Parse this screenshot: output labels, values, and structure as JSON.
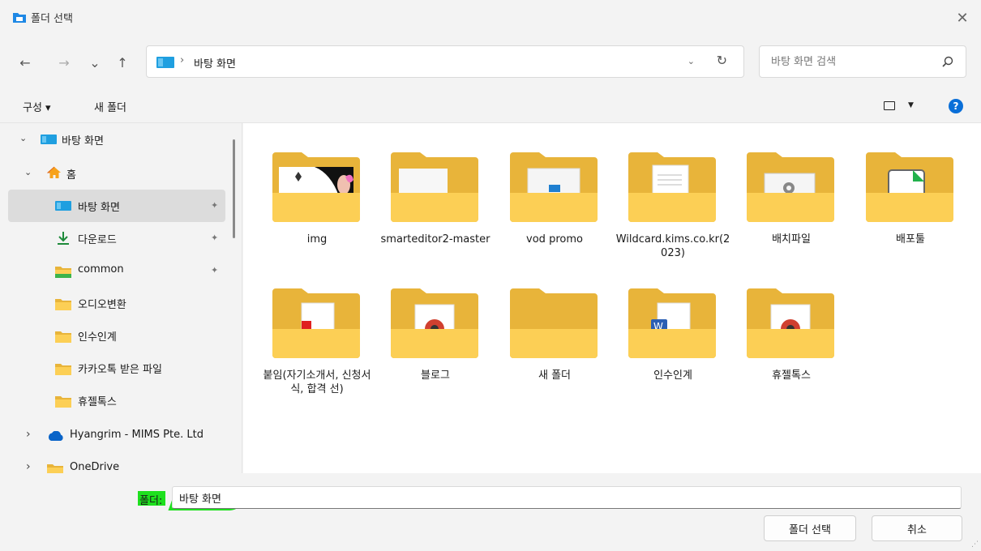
{
  "window": {
    "title": "폴더 선택",
    "close_glyph": "✕"
  },
  "nav": {
    "back_glyph": "←",
    "forward_glyph": "→",
    "recent_glyph": "⌄",
    "up_glyph": "↑",
    "breadcrumb_sep": "›",
    "path": "바탕 화면",
    "dropdown_glyph": "⌄",
    "refresh_glyph": "↻",
    "search_placeholder": "바탕 화면 검색"
  },
  "toolbar": {
    "organize": "구성 ▾",
    "new_folder": "새 폴더",
    "help": "?"
  },
  "sidebar": {
    "items": [
      {
        "label": "바탕 화면",
        "chevron": "⌄",
        "icon": "desktop-icon"
      },
      {
        "label": "홈",
        "chevron": "⌄",
        "icon": "home-icon"
      },
      {
        "label": "바탕 화면",
        "icon": "desktop-icon",
        "pinned": true
      },
      {
        "label": "다운로드",
        "icon": "download-icon",
        "pinned": true
      },
      {
        "label": "common",
        "icon": "folder-icon",
        "pinned": true
      },
      {
        "label": "오디오변환",
        "icon": "folder-icon"
      },
      {
        "label": "인수인계",
        "icon": "folder-icon"
      },
      {
        "label": "카카오톡 받은 파일",
        "icon": "folder-icon"
      },
      {
        "label": "휴젤톡스",
        "icon": "folder-icon"
      },
      {
        "label": "Hyangrim - MIMS Pte. Ltd",
        "chevron": "›",
        "icon": "cloud-icon"
      },
      {
        "label": "OneDrive",
        "chevron": "›",
        "icon": "folder-icon"
      }
    ],
    "pin_glyph": "📌"
  },
  "folders": [
    {
      "name": "img",
      "preview": "image"
    },
    {
      "name": "smarteditor2-master",
      "preview": "plain"
    },
    {
      "name": "vod promo",
      "preview": "video"
    },
    {
      "name": "Wildcard.kims.co.kr(2023)",
      "preview": "document"
    },
    {
      "name": "배치파일",
      "preview": "gear"
    },
    {
      "name": "배포툴",
      "preview": "file"
    },
    {
      "name": "붙임(자기소개서, 신청서식, 합격 선)",
      "preview": "pdf"
    },
    {
      "name": "블로그",
      "preview": "chrome"
    },
    {
      "name": "새 폴더",
      "preview": "empty"
    },
    {
      "name": "인수인계",
      "preview": "word"
    },
    {
      "name": "휴젤톡스",
      "preview": "chrome"
    }
  ],
  "footer": {
    "folder_label": "폴더:",
    "folder_value": "바탕 화면",
    "select_button": "폴더 선택",
    "cancel_button": "취소"
  },
  "colors": {
    "folder_back": "#e8b43a",
    "folder_front": "#fccf55",
    "accent": "#0a6fd8",
    "highlight": "#1ee01e"
  }
}
